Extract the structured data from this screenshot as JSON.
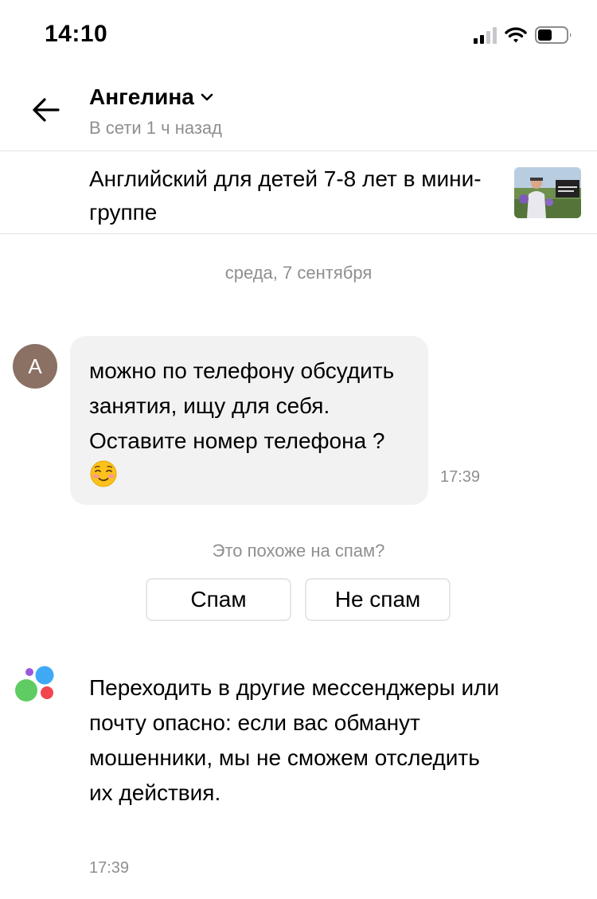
{
  "status_bar": {
    "time": "14:10",
    "signal_bars_active": 2,
    "battery_level": 0.45
  },
  "header": {
    "name": "Ангелина",
    "presence": "В сети 1 ч назад"
  },
  "listing": {
    "title": "Английский для детей 7-8 лет в мини-группе"
  },
  "date_separator": "среда, 7 сентября",
  "incoming_message": {
    "avatar_letter": "A",
    "text": "можно по телефону обсудить занятия, ищу для себя. Оставите номер телефона ?",
    "emoji_icon": "smiling-face-emoji",
    "time": "17:39"
  },
  "spam_prompt": {
    "question": "Это похоже на спам?",
    "spam_label": "Спам",
    "not_spam_label": "Не спам"
  },
  "system_message": {
    "text": "Переходить в другие мессенджеры или почту опасно: если вас обманут мошенники, мы не сможем отследить их действия.",
    "time": "17:39"
  },
  "colors": {
    "bubble": "#f2f2f2",
    "muted_text": "#8f8f8f",
    "avatar": "#8a7163",
    "logo_blue": "#3fa9f5",
    "logo_green": "#5ecc62",
    "logo_red": "#f34550",
    "logo_purple": "#9a58e0"
  }
}
